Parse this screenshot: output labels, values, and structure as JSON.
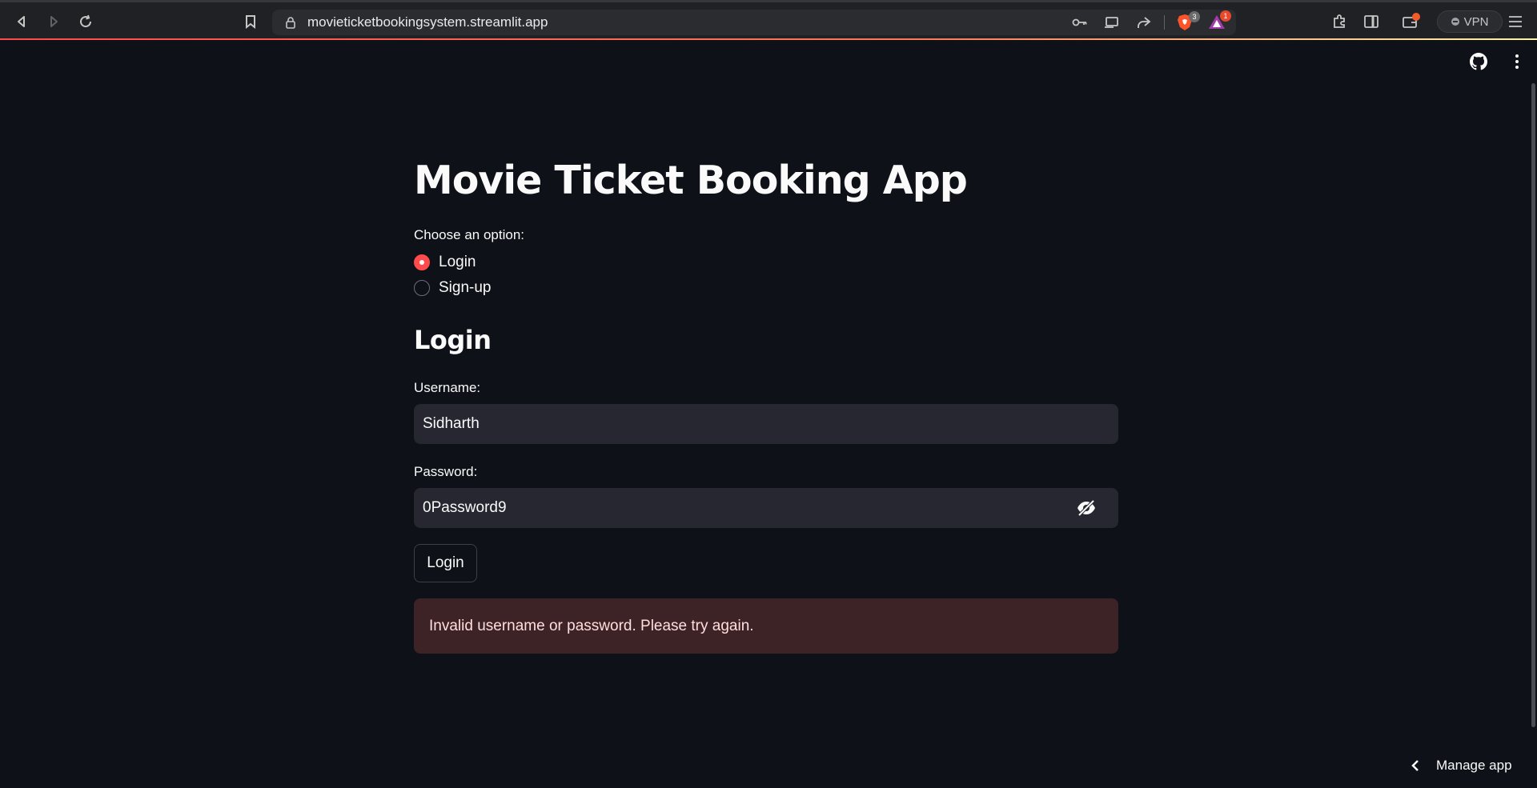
{
  "browser": {
    "url": "movieticketbookingsystem.streamlit.app",
    "brave_shields_count": "3",
    "rewards_count": "1",
    "vpn_label": "VPN"
  },
  "app": {
    "title": "Movie Ticket Booking App",
    "option_label": "Choose an option:",
    "options": [
      {
        "label": "Login",
        "selected": true
      },
      {
        "label": "Sign-up",
        "selected": false
      }
    ],
    "section_title": "Login",
    "username_label": "Username:",
    "username_value": "Sidharth",
    "password_label": "Password:",
    "password_value": "0Password9",
    "login_button": "Login",
    "error_message": "Invalid username or password. Please try again.",
    "manage_app": "Manage app"
  },
  "colors": {
    "background": "#0e1117",
    "accent": "#ff4b4b",
    "input_bg": "#262730",
    "error_bg": "#3e2326"
  }
}
